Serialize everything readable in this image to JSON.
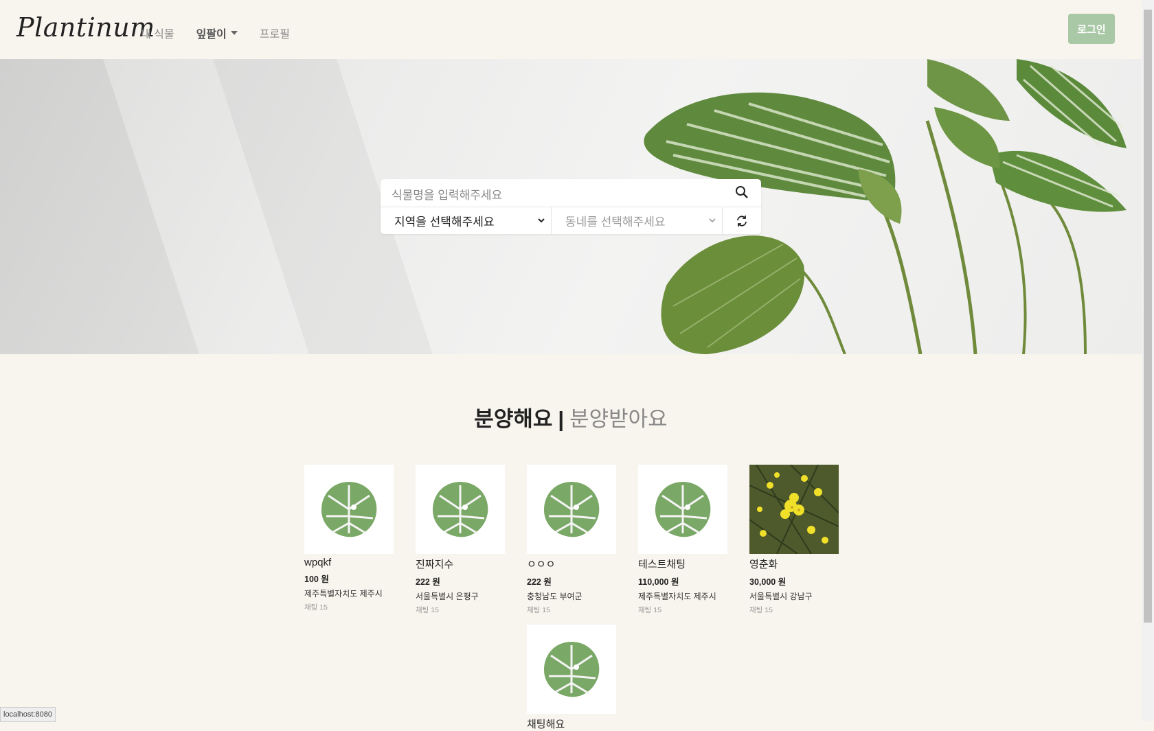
{
  "nav": {
    "brand": "Plantinum",
    "links": [
      {
        "label": "내 식물"
      },
      {
        "label": "잎팔이"
      },
      {
        "label": "프로필"
      }
    ],
    "login_label": "로그인",
    "accent_color": "#a9c8a5"
  },
  "search": {
    "placeholder": "식물명을 입력해주세요",
    "region_select": "지역을 선택해주세요",
    "town_select": "동네를 선택해주세요"
  },
  "section": {
    "share_label": "분양해요",
    "separator": "|",
    "receive_label": "분양받아요"
  },
  "listings": [
    {
      "name": "wpqkf",
      "price": "100 원",
      "location": "제주특별자치도 제주시",
      "chat": "채팅 15",
      "image": "monstera-leaf"
    },
    {
      "name": "진짜지수",
      "price": "222 원",
      "location": "서울특별시 은평구",
      "chat": "채팅 15",
      "image": "monstera-leaf"
    },
    {
      "name": "ㅇㅇㅇ",
      "price": "222 원",
      "location": "충청남도 부여군",
      "chat": "채팅 15",
      "image": "monstera-leaf"
    },
    {
      "name": "테스트채팅",
      "price": "110,000 원",
      "location": "제주특별자치도 제주시",
      "chat": "채팅 15",
      "image": "monstera-leaf"
    },
    {
      "name": "영춘화",
      "price": "30,000 원",
      "location": "서울특별시 강남구",
      "chat": "채팅 15",
      "image": "yellow-flower-photo"
    },
    {
      "name": "채팅해요",
      "price": "",
      "location": "",
      "chat": "",
      "image": "monstera-leaf"
    }
  ],
  "status_bar": "localhost:8080"
}
